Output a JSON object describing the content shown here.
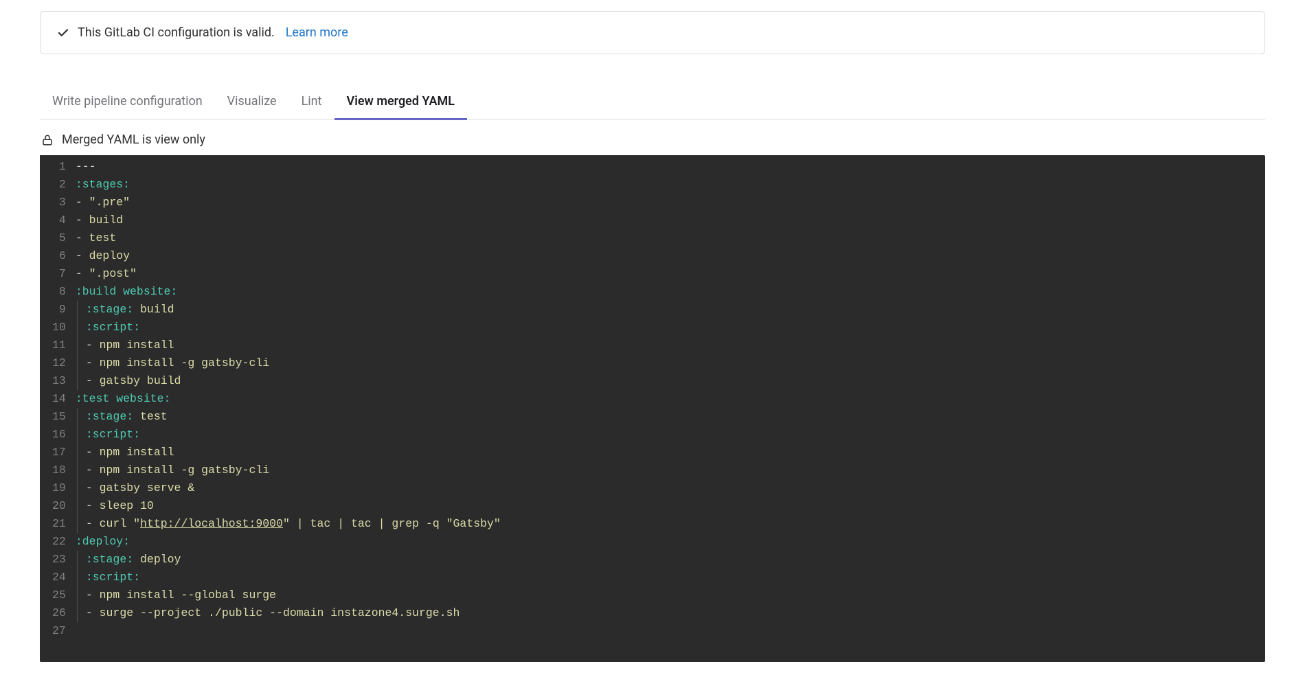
{
  "banner": {
    "message": "This GitLab CI configuration is valid.",
    "learn_more": "Learn more"
  },
  "tabs": [
    {
      "label": "Write pipeline configuration",
      "active": false
    },
    {
      "label": "Visualize",
      "active": false
    },
    {
      "label": "Lint",
      "active": false
    },
    {
      "label": "View merged YAML",
      "active": true
    }
  ],
  "notice": "Merged YAML is view only",
  "editor": {
    "line_count": 27,
    "lines": [
      {
        "n": 1,
        "indent": 0,
        "tokens": [
          {
            "t": "---",
            "c": "tok-plain"
          }
        ]
      },
      {
        "n": 2,
        "indent": 0,
        "tokens": [
          {
            "t": ":stages:",
            "c": "tok-key"
          }
        ]
      },
      {
        "n": 3,
        "indent": 0,
        "tokens": [
          {
            "t": "- ",
            "c": "tok-dash"
          },
          {
            "t": "\".pre\"",
            "c": "tok-str"
          }
        ]
      },
      {
        "n": 4,
        "indent": 0,
        "tokens": [
          {
            "t": "- ",
            "c": "tok-dash"
          },
          {
            "t": "build",
            "c": "tok-val"
          }
        ]
      },
      {
        "n": 5,
        "indent": 0,
        "tokens": [
          {
            "t": "- ",
            "c": "tok-dash"
          },
          {
            "t": "test",
            "c": "tok-val"
          }
        ]
      },
      {
        "n": 6,
        "indent": 0,
        "tokens": [
          {
            "t": "- ",
            "c": "tok-dash"
          },
          {
            "t": "deploy",
            "c": "tok-val"
          }
        ]
      },
      {
        "n": 7,
        "indent": 0,
        "tokens": [
          {
            "t": "- ",
            "c": "tok-dash"
          },
          {
            "t": "\".post\"",
            "c": "tok-str"
          }
        ]
      },
      {
        "n": 8,
        "indent": 0,
        "tokens": [
          {
            "t": ":build website:",
            "c": "tok-key"
          }
        ]
      },
      {
        "n": 9,
        "indent": 1,
        "tokens": [
          {
            "t": ":stage:",
            "c": "tok-key"
          },
          {
            "t": " build",
            "c": "tok-val"
          }
        ]
      },
      {
        "n": 10,
        "indent": 1,
        "tokens": [
          {
            "t": ":script:",
            "c": "tok-key"
          }
        ]
      },
      {
        "n": 11,
        "indent": 1,
        "tokens": [
          {
            "t": "- ",
            "c": "tok-dash"
          },
          {
            "t": "npm install",
            "c": "tok-val"
          }
        ]
      },
      {
        "n": 12,
        "indent": 1,
        "tokens": [
          {
            "t": "- ",
            "c": "tok-dash"
          },
          {
            "t": "npm install -g gatsby-cli",
            "c": "tok-val"
          }
        ]
      },
      {
        "n": 13,
        "indent": 1,
        "tokens": [
          {
            "t": "- ",
            "c": "tok-dash"
          },
          {
            "t": "gatsby build",
            "c": "tok-val"
          }
        ]
      },
      {
        "n": 14,
        "indent": 0,
        "tokens": [
          {
            "t": ":test website:",
            "c": "tok-key"
          }
        ]
      },
      {
        "n": 15,
        "indent": 1,
        "tokens": [
          {
            "t": ":stage:",
            "c": "tok-key"
          },
          {
            "t": " test",
            "c": "tok-val"
          }
        ]
      },
      {
        "n": 16,
        "indent": 1,
        "tokens": [
          {
            "t": ":script:",
            "c": "tok-key"
          }
        ]
      },
      {
        "n": 17,
        "indent": 1,
        "tokens": [
          {
            "t": "- ",
            "c": "tok-dash"
          },
          {
            "t": "npm install",
            "c": "tok-val"
          }
        ]
      },
      {
        "n": 18,
        "indent": 1,
        "tokens": [
          {
            "t": "- ",
            "c": "tok-dash"
          },
          {
            "t": "npm install -g gatsby-cli",
            "c": "tok-val"
          }
        ]
      },
      {
        "n": 19,
        "indent": 1,
        "tokens": [
          {
            "t": "- ",
            "c": "tok-dash"
          },
          {
            "t": "gatsby serve &",
            "c": "tok-val"
          }
        ]
      },
      {
        "n": 20,
        "indent": 1,
        "tokens": [
          {
            "t": "- ",
            "c": "tok-dash"
          },
          {
            "t": "sleep 10",
            "c": "tok-val"
          }
        ]
      },
      {
        "n": 21,
        "indent": 1,
        "tokens": [
          {
            "t": "- ",
            "c": "tok-dash"
          },
          {
            "t": "curl \"",
            "c": "tok-val"
          },
          {
            "t": "http://localhost:9000",
            "c": "tok-url"
          },
          {
            "t": "\" | tac | tac | grep -q \"Gatsby\"",
            "c": "tok-val"
          }
        ]
      },
      {
        "n": 22,
        "indent": 0,
        "tokens": [
          {
            "t": ":deploy:",
            "c": "tok-key"
          }
        ]
      },
      {
        "n": 23,
        "indent": 1,
        "tokens": [
          {
            "t": ":stage:",
            "c": "tok-key"
          },
          {
            "t": " deploy",
            "c": "tok-val"
          }
        ]
      },
      {
        "n": 24,
        "indent": 1,
        "tokens": [
          {
            "t": ":script:",
            "c": "tok-key"
          }
        ]
      },
      {
        "n": 25,
        "indent": 1,
        "tokens": [
          {
            "t": "- ",
            "c": "tok-dash"
          },
          {
            "t": "npm install --global surge",
            "c": "tok-val"
          }
        ]
      },
      {
        "n": 26,
        "indent": 1,
        "tokens": [
          {
            "t": "- ",
            "c": "tok-dash"
          },
          {
            "t": "surge --project ./public --domain instazone4.surge.sh",
            "c": "tok-val"
          }
        ]
      },
      {
        "n": 27,
        "indent": 0,
        "tokens": []
      }
    ]
  }
}
